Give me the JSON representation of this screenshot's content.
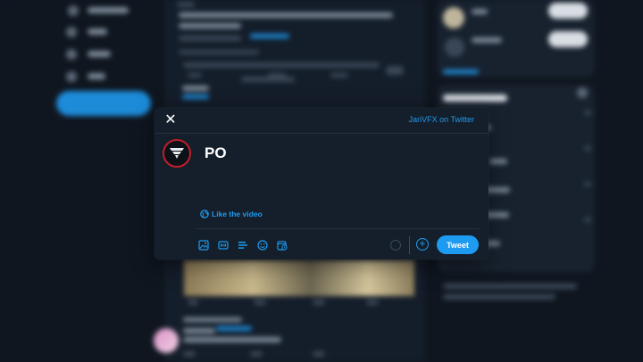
{
  "compose": {
    "close_label": "✕",
    "account_link": "JariVFX on Twitter",
    "tweet_text": "PO",
    "reply_setting": "Like the video",
    "tweet_button": "Tweet",
    "add_button": "+"
  },
  "icons": {
    "close": "close-icon",
    "globe": "globe-icon",
    "media": "image-icon",
    "gif": "gif-icon",
    "poll": "poll-icon",
    "emoji": "emoji-icon",
    "schedule": "schedule-icon"
  },
  "colors": {
    "accent": "#1d9bf0",
    "dialog_bg": "#151f2b",
    "page_bg": "#0f1823",
    "avatar_ring": "#c21d2c"
  }
}
